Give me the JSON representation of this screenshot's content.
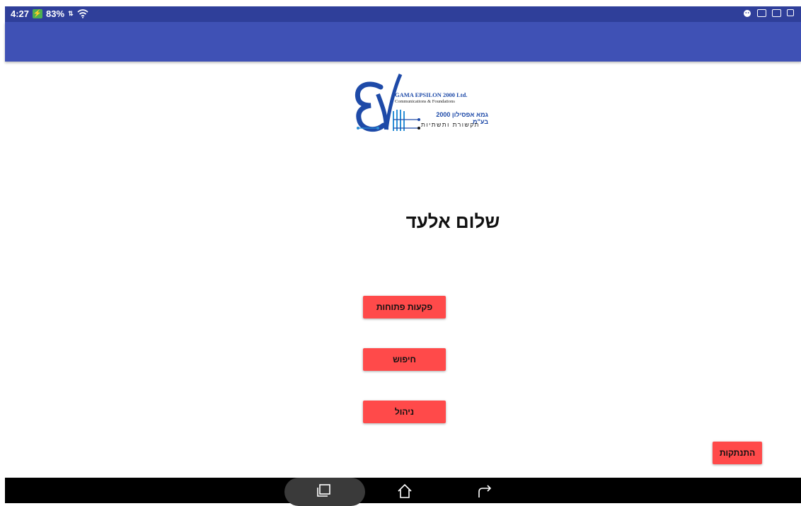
{
  "status_bar": {
    "time": "4:27",
    "battery": "83%",
    "bg_color": "#2f3f9a"
  },
  "app_bar": {
    "color": "#3f51b5"
  },
  "logo": {
    "line1": "GAMA EPSILON 2000 Ltd.",
    "line2": "Communications & Foundations",
    "hebrew_line1": "גמא אפסילון 2000 בע\"מ",
    "hebrew_line2": "תקשורת ותשתיות"
  },
  "greeting": "שלום אלעד",
  "buttons": {
    "open_tickets": "פקעות פתוחות",
    "search": "חיפוש",
    "manage": "ניהול",
    "logout": "התנתקות",
    "color": "#ff4a4a"
  },
  "nav_icons": [
    "recent-apps-icon",
    "home-icon",
    "back-icon"
  ]
}
